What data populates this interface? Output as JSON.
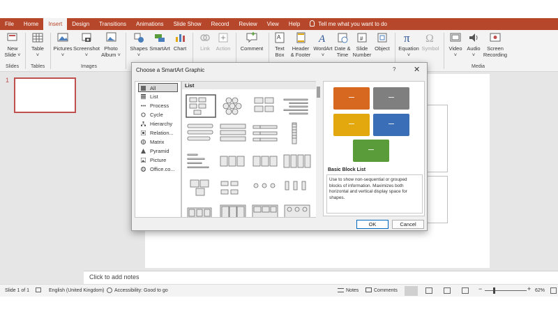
{
  "ribbon_tabs": [
    {
      "label": "File"
    },
    {
      "label": "Home"
    },
    {
      "label": "Insert"
    },
    {
      "label": "Design"
    },
    {
      "label": "Transitions"
    },
    {
      "label": "Animations"
    },
    {
      "label": "Slide Show"
    },
    {
      "label": "Record"
    },
    {
      "label": "Review"
    },
    {
      "label": "View"
    },
    {
      "label": "Help"
    }
  ],
  "active_tab": "Insert",
  "tell_me": "Tell me what you want to do",
  "ribbon": {
    "buttons": [
      {
        "label": "New",
        "label2": "Slide ˅",
        "icon": "new-slide-icon"
      },
      {
        "label": "Table",
        "label2": "˅",
        "icon": "table-icon"
      },
      {
        "label": "Pictures",
        "label2": "˅",
        "icon": "pictures-icon"
      },
      {
        "label": "Screenshot",
        "label2": "˅",
        "icon": "screenshot-icon"
      },
      {
        "label": "Photo",
        "label2": "Album ˅",
        "icon": "photo-album-icon"
      },
      {
        "label": "Shapes",
        "label2": "˅",
        "icon": "shapes-icon"
      },
      {
        "label": "SmartArt",
        "label2": "",
        "icon": "smartart-icon"
      },
      {
        "label": "Chart",
        "label2": "",
        "icon": "chart-icon"
      },
      {
        "label": "Link",
        "label2": "",
        "icon": "link-icon",
        "disabled": true
      },
      {
        "label": "Action",
        "label2": "",
        "icon": "action-icon",
        "disabled": true
      },
      {
        "label": "Comment",
        "label2": "",
        "icon": "comment-icon"
      },
      {
        "label": "Text",
        "label2": "Box",
        "icon": "text-box-icon"
      },
      {
        "label": "Header",
        "label2": "& Footer",
        "icon": "header-footer-icon"
      },
      {
        "label": "WordArt",
        "label2": "˅",
        "icon": "wordart-icon"
      },
      {
        "label": "Date &",
        "label2": "Time",
        "icon": "date-time-icon"
      },
      {
        "label": "Slide",
        "label2": "Number",
        "icon": "slide-number-icon"
      },
      {
        "label": "Object",
        "label2": "",
        "icon": "object-icon"
      },
      {
        "label": "Equation",
        "label2": "˅",
        "icon": "equation-icon"
      },
      {
        "label": "Symbol",
        "label2": "",
        "icon": "symbol-icon",
        "disabled": true
      },
      {
        "label": "Video",
        "label2": "˅",
        "icon": "video-icon"
      },
      {
        "label": "Audio",
        "label2": "˅",
        "icon": "audio-icon"
      },
      {
        "label": "Screen",
        "label2": "Recording",
        "icon": "screen-recording-icon"
      }
    ],
    "groups": [
      "Slides",
      "Tables",
      "Images",
      "Media"
    ]
  },
  "slide_thumbnail_number": "1",
  "notes_placeholder": "Click to add notes",
  "status_bar": {
    "slide_info": "Slide 1 of 1",
    "language": "English (United Kingdom)",
    "accessibility": "Accessibility: Good to go",
    "notes": "Notes",
    "comments": "Comments",
    "zoom": "62%"
  },
  "dialog": {
    "title": "Choose a SmartArt Graphic",
    "help": "?",
    "close": "✕",
    "categories": [
      {
        "label": "All",
        "icon": "all-icon"
      },
      {
        "label": "List",
        "icon": "list-icon"
      },
      {
        "label": "Process",
        "icon": "process-icon"
      },
      {
        "label": "Cycle",
        "icon": "cycle-icon"
      },
      {
        "label": "Hierarchy",
        "icon": "hierarchy-icon"
      },
      {
        "label": "Relation...",
        "icon": "relationship-icon"
      },
      {
        "label": "Matrix",
        "icon": "matrix-icon"
      },
      {
        "label": "Pyramid",
        "icon": "pyramid-icon"
      },
      {
        "label": "Picture",
        "icon": "picture-icon"
      },
      {
        "label": "Office.co...",
        "icon": "office-com-icon"
      }
    ],
    "selected_category": "All",
    "gallery_header": "List",
    "preview_name": "Basic Block List",
    "preview_description": "Use to show non-sequential or grouped blocks of information. Maximizes both horizontal and vertical display space for shapes.",
    "preview_colors": [
      "#d6681f",
      "#7f7f7f",
      "#e3a80d",
      "#3a6fb8",
      "#5b9c3a"
    ],
    "preview_dash": "—",
    "ok_label": "OK",
    "cancel_label": "Cancel"
  }
}
